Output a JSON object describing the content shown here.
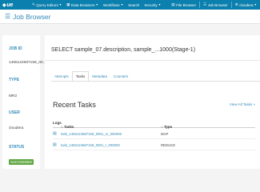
{
  "topnav": {
    "logo_text": "ue",
    "items": [
      {
        "label": "Query Editors",
        "icon": "pencil-icon"
      },
      {
        "label": "Data Browsers",
        "icon": "grid-icon"
      },
      {
        "label": "Workflows"
      },
      {
        "label": "Search"
      },
      {
        "label": "Security"
      }
    ],
    "right": [
      {
        "label": "File Browser",
        "icon": "file-icon"
      },
      {
        "label": "Job Browser",
        "icon": "list-icon"
      },
      {
        "label": "cloudera",
        "icon": "cog-icon"
      }
    ]
  },
  "subnav": {
    "title": "Job Browser",
    "icon": "job-browser-icon"
  },
  "sidebar": {
    "job_id_label": "JOB ID",
    "job_id_value": "1465124687159_00...",
    "type_label": "TYPE",
    "type_value": "MR2",
    "user_label": "USER",
    "user_value": "cloudera",
    "status_label": "STATUS",
    "status_value": "SUCCEEDED"
  },
  "main": {
    "title": "SELECT sample_07.description, sample_...1000(Stage-1)",
    "tabs": [
      "Attempts",
      "Tasks",
      "Metadata",
      "Counters"
    ],
    "active_tab": "Tasks",
    "section_title": "Recent Tasks",
    "view_all": "View All Tasks »",
    "table": {
      "headers": {
        "logs": "Logs",
        "tasks": "Tasks",
        "type": "Type"
      },
      "rows": [
        {
          "task": "task_1465124687159_0001_m_000000",
          "type": "MAP"
        },
        {
          "task": "task_1465124687159_0001_r_000000",
          "type": "REDUCE"
        }
      ]
    }
  },
  "colors": {
    "topbar": "#0b7fad",
    "accent": "#338bb8",
    "success": "#5ea640"
  }
}
